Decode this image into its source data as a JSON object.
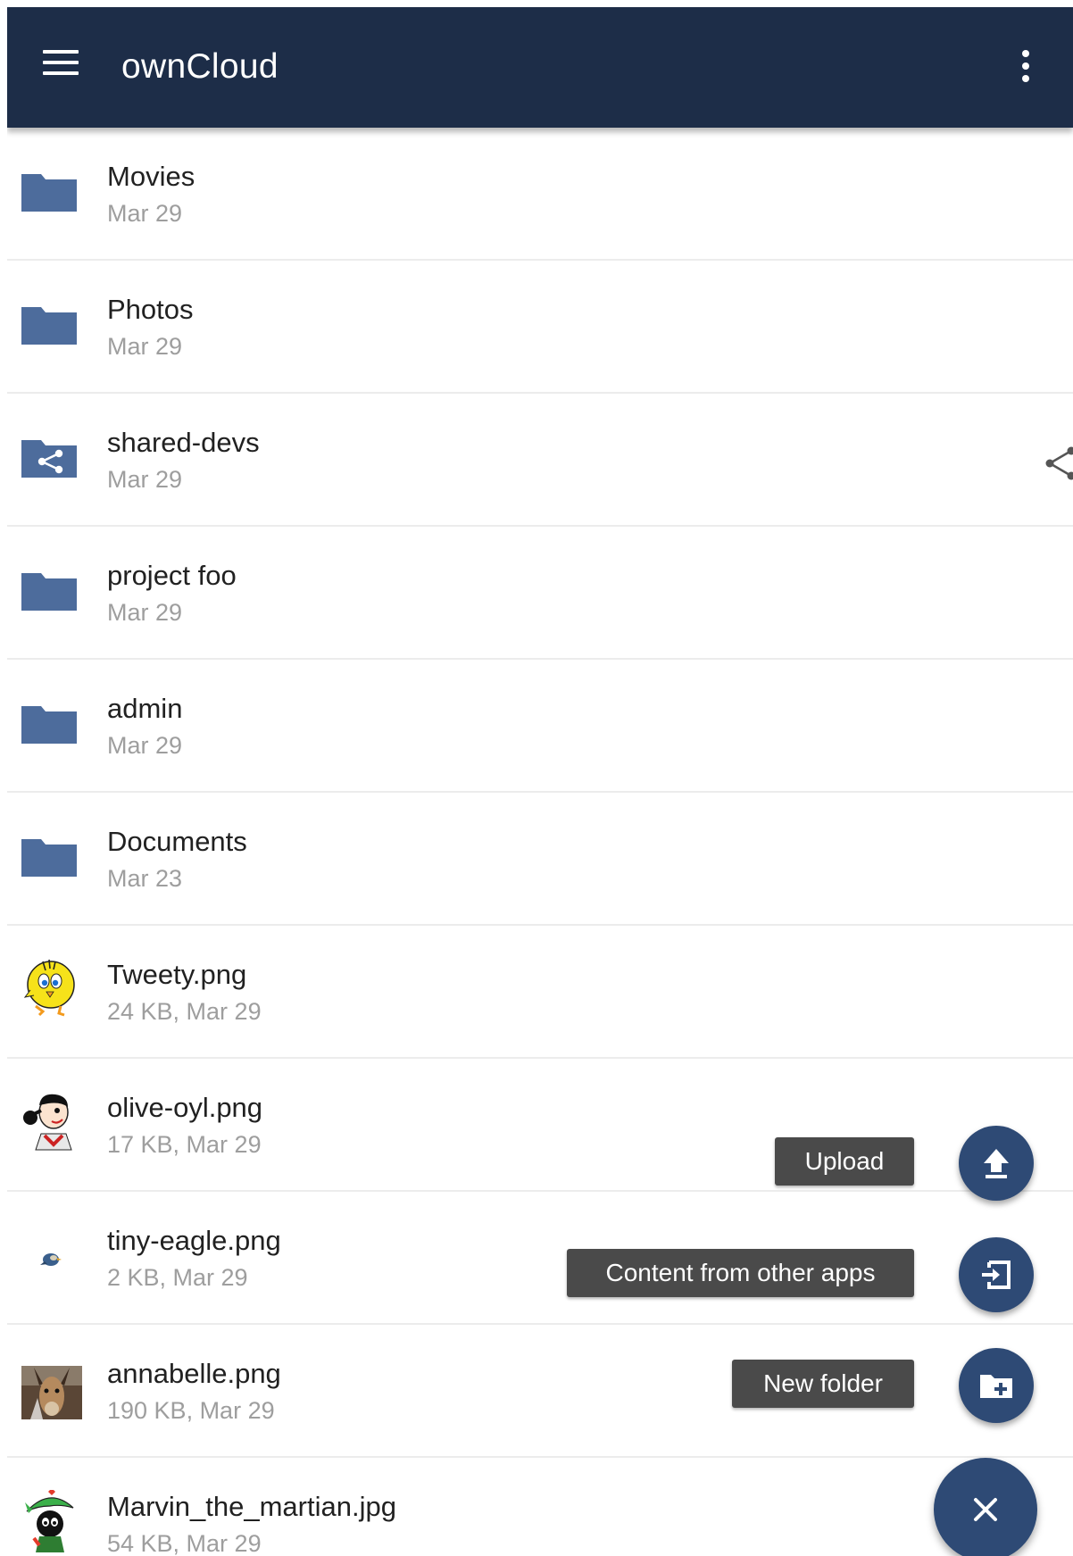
{
  "app_bar": {
    "title": "ownCloud",
    "menu_icon": "hamburger-menu-icon",
    "overflow_icon": "more-vert-icon",
    "background_color": "#1d2d48"
  },
  "files": [
    {
      "name": "Movies",
      "meta": "Mar 29",
      "kind": "folder",
      "icon": "folder-icon"
    },
    {
      "name": "Photos",
      "meta": "Mar 29",
      "kind": "folder",
      "icon": "folder-icon"
    },
    {
      "name": "shared-devs",
      "meta": "Mar 29",
      "kind": "shared-folder",
      "icon": "shared-folder-icon",
      "shared": true
    },
    {
      "name": "project foo",
      "meta": "Mar 29",
      "kind": "folder",
      "icon": "folder-icon"
    },
    {
      "name": "admin",
      "meta": "Mar 29",
      "kind": "folder",
      "icon": "folder-icon"
    },
    {
      "name": "Documents",
      "meta": "Mar 23",
      "kind": "folder",
      "icon": "folder-icon"
    },
    {
      "name": "Tweety.png",
      "meta": "24 KB, Mar 29",
      "kind": "image",
      "icon": "tweety-thumbnail"
    },
    {
      "name": "olive-oyl.png",
      "meta": "17 KB, Mar 29",
      "kind": "image",
      "icon": "olive-oyl-thumbnail"
    },
    {
      "name": "tiny-eagle.png",
      "meta": "2 KB, Mar 29",
      "kind": "image",
      "icon": "tiny-eagle-thumbnail"
    },
    {
      "name": "annabelle.png",
      "meta": "190 KB, Mar 29",
      "kind": "image",
      "icon": "annabelle-thumbnail"
    },
    {
      "name": "Marvin_the_martian.jpg",
      "meta": "54 KB, Mar 29",
      "kind": "image",
      "icon": "marvin-thumbnail"
    }
  ],
  "fab_menu": {
    "upload_label": "Upload",
    "upload_icon": "upload-icon",
    "content_label": "Content from other apps",
    "content_icon": "import-icon",
    "new_folder_label": "New folder",
    "new_folder_icon": "create-folder-icon",
    "close_icon": "close-icon",
    "fab_color": "#2e4a75",
    "label_color": "#4a4a4a"
  },
  "colors": {
    "folder": "#4d6c9c",
    "secondary_text": "#9e9e9e",
    "primary_text": "#212121"
  }
}
